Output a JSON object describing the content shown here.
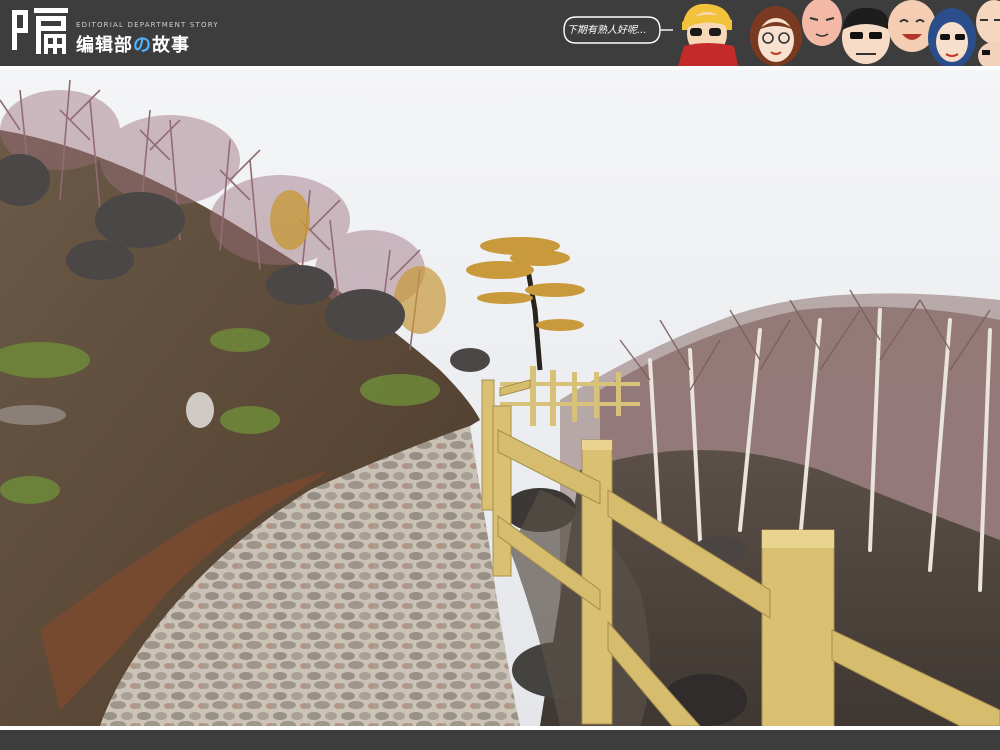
{
  "header": {
    "logo_en": "EDITORIAL DEPARTMENT STORY",
    "logo_zh_before": "编辑部",
    "logo_zh_o": "の",
    "logo_zh_after": "故事",
    "bubble_text": "下期有熟人好呢..."
  },
  "icons": {
    "logo": "bian-character-logo",
    "bubble": "speech-bubble-icon",
    "faces": "cartoon-face-avatars"
  },
  "colors": {
    "header_bg": "#3d3d3d",
    "accent_blue": "#4fb3ff",
    "fence_wood": "#d8c27a"
  }
}
